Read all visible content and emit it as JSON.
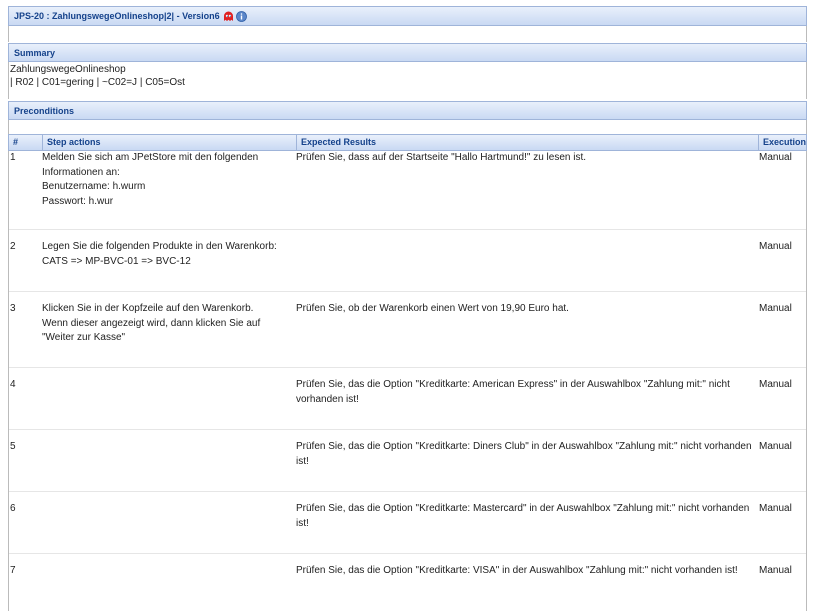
{
  "header": {
    "title": "JPS-20 : ZahlungswegeOnlineshop|2| - Version6",
    "ghost_icon": "ghost-icon",
    "info_icon": "info-icon"
  },
  "summary": {
    "label": "Summary",
    "line1": "ZahlungswegeOnlineshop",
    "line2": "| R02 | C01=gering | ~C02=J | C05=Ost"
  },
  "preconditions": {
    "label": "Preconditions"
  },
  "table": {
    "columns": [
      "#",
      "Step actions",
      "Expected Results",
      "Execution"
    ],
    "rows": [
      {
        "num": "1",
        "step": "Melden Sie sich am JPetStore mit den folgenden\nInformationen an:\nBenutzername: h.wurm\nPasswort: h.wur",
        "expected": "Prüfen Sie, dass auf der Startseite \"Hallo Hartmund!\" zu lesen ist.",
        "execution": "Manual"
      },
      {
        "num": "2",
        "step": "Legen Sie die folgenden Produkte in den Warenkorb:\nCATS => MP-BVC-01 => BVC-12",
        "expected": "",
        "execution": "Manual"
      },
      {
        "num": "3",
        "step": "Klicken Sie in der Kopfzeile auf den Warenkorb.\nWenn dieser angezeigt wird, dann klicken Sie auf\n\"Weiter zur Kasse\"",
        "expected": "Prüfen Sie, ob der Warenkorb einen Wert von 19,90 Euro hat.",
        "execution": "Manual"
      },
      {
        "num": "4",
        "step": "",
        "expected": "Prüfen Sie, das die Option \"Kreditkarte: American Express\" in der Auswahlbox \"Zahlung mit:\" nicht\nvorhanden ist!",
        "execution": "Manual"
      },
      {
        "num": "5",
        "step": "",
        "expected": "Prüfen Sie, das die Option \"Kreditkarte: Diners Club\" in der Auswahlbox \"Zahlung mit:\" nicht vorhanden\nist!",
        "execution": "Manual"
      },
      {
        "num": "6",
        "step": "",
        "expected": "Prüfen Sie, das die Option \"Kreditkarte: Mastercard\" in der Auswahlbox \"Zahlung mit:\" nicht vorhanden\nist!",
        "execution": "Manual"
      },
      {
        "num": "7",
        "step": "",
        "expected": "Prüfen Sie, das die Option \"Kreditkarte: VISA\" in der Auswahlbox \"Zahlung mit:\" nicht vorhanden ist!",
        "execution": "Manual"
      }
    ]
  }
}
